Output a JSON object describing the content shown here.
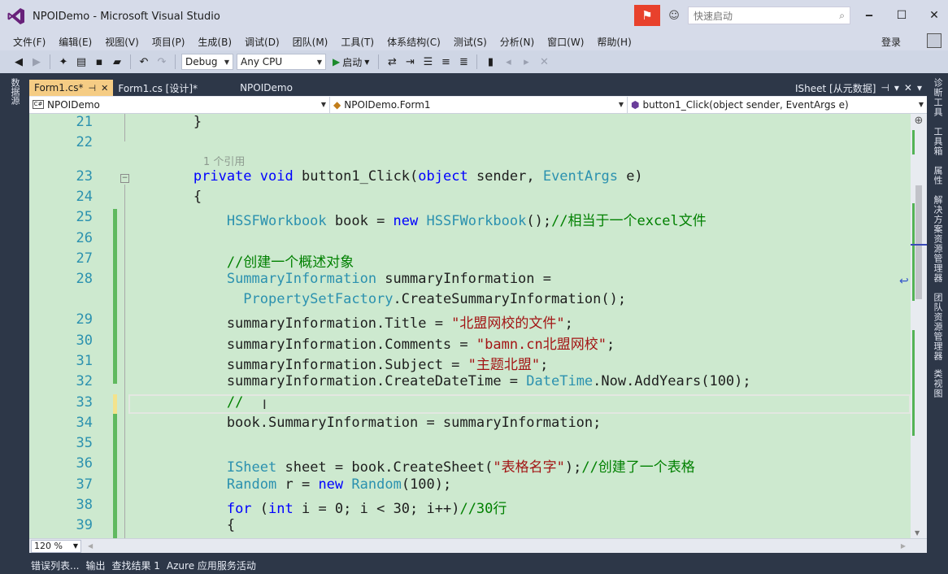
{
  "window": {
    "title": "NPOIDemo - Microsoft Visual Studio",
    "quick_launch_placeholder": "快速启动",
    "login": "登录"
  },
  "menu": [
    "文件(F)",
    "编辑(E)",
    "视图(V)",
    "项目(P)",
    "生成(B)",
    "调试(D)",
    "团队(M)",
    "工具(T)",
    "体系结构(C)",
    "测试(S)",
    "分析(N)",
    "窗口(W)",
    "帮助(H)"
  ],
  "toolbar": {
    "config": "Debug",
    "platform": "Any CPU",
    "start_label": "启动"
  },
  "left_side_tabs": [
    "数据源"
  ],
  "right_side_tabs": [
    "诊断工具",
    "工具箱",
    "属性",
    "解决方案资源管理器",
    "团队资源管理器",
    "类视图"
  ],
  "doc_tabs": [
    {
      "label": "Form1.cs*",
      "active": true
    },
    {
      "label": "Form1.cs [设计]*",
      "active": false
    },
    {
      "label": "NPOIDemo",
      "active": false
    }
  ],
  "doc_tabs_right_label": "ISheet [从元数据]",
  "navbar": {
    "project_icon": "C#",
    "project": "NPOIDemo",
    "class": "NPOIDemo.Form1",
    "member": "button1_Click(object sender, EventArgs e)"
  },
  "codelens": "1 个引用",
  "code": [
    {
      "num": "21",
      "tokens": [
        {
          "t": "        }",
          "c": ""
        }
      ]
    },
    {
      "num": "22",
      "tokens": []
    },
    {
      "num": "23",
      "tokens": [
        {
          "t": "        ",
          "c": ""
        },
        {
          "t": "private",
          "c": "kw"
        },
        {
          "t": " ",
          "c": ""
        },
        {
          "t": "void",
          "c": "kw"
        },
        {
          "t": " button1_Click(",
          "c": ""
        },
        {
          "t": "object",
          "c": "kw"
        },
        {
          "t": " sender, ",
          "c": ""
        },
        {
          "t": "EventArgs",
          "c": "ty"
        },
        {
          "t": " e)",
          "c": ""
        }
      ]
    },
    {
      "num": "24",
      "tokens": [
        {
          "t": "        {",
          "c": ""
        }
      ]
    },
    {
      "num": "25",
      "tokens": [
        {
          "t": "            ",
          "c": ""
        },
        {
          "t": "HSSFWorkbook",
          "c": "ty"
        },
        {
          "t": " book = ",
          "c": ""
        },
        {
          "t": "new",
          "c": "kw"
        },
        {
          "t": " ",
          "c": ""
        },
        {
          "t": "HSSFWorkbook",
          "c": "ty"
        },
        {
          "t": "();",
          "c": ""
        },
        {
          "t": "//相当于一个excel文件",
          "c": "cm"
        }
      ]
    },
    {
      "num": "26",
      "tokens": []
    },
    {
      "num": "27",
      "tokens": [
        {
          "t": "            ",
          "c": ""
        },
        {
          "t": "//创建一个概述对象",
          "c": "cm"
        }
      ]
    },
    {
      "num": "28",
      "tokens": [
        {
          "t": "            ",
          "c": ""
        },
        {
          "t": "SummaryInformation",
          "c": "ty"
        },
        {
          "t": " summaryInformation =",
          "c": ""
        }
      ]
    },
    {
      "num": "",
      "tokens": [
        {
          "t": "              ",
          "c": ""
        },
        {
          "t": "PropertySetFactory",
          "c": "ty"
        },
        {
          "t": ".CreateSummaryInformation();",
          "c": ""
        }
      ]
    },
    {
      "num": "29",
      "tokens": [
        {
          "t": "            summaryInformation.Title = ",
          "c": ""
        },
        {
          "t": "\"北盟网校的文件\"",
          "c": "str"
        },
        {
          "t": ";",
          "c": ""
        }
      ]
    },
    {
      "num": "30",
      "tokens": [
        {
          "t": "            summaryInformation.Comments = ",
          "c": ""
        },
        {
          "t": "\"bamn.cn北盟网校\"",
          "c": "str"
        },
        {
          "t": ";",
          "c": ""
        }
      ]
    },
    {
      "num": "31",
      "tokens": [
        {
          "t": "            summaryInformation.Subject = ",
          "c": ""
        },
        {
          "t": "\"主题北盟\"",
          "c": "str"
        },
        {
          "t": ";",
          "c": ""
        }
      ]
    },
    {
      "num": "32",
      "tokens": [
        {
          "t": "            summaryInformation.CreateDateTime = ",
          "c": ""
        },
        {
          "t": "DateTime",
          "c": "ty"
        },
        {
          "t": ".Now.AddYears(100);",
          "c": ""
        }
      ]
    },
    {
      "num": "33",
      "tokens": [
        {
          "t": "            ",
          "c": ""
        },
        {
          "t": "//",
          "c": "cm"
        }
      ]
    },
    {
      "num": "34",
      "tokens": [
        {
          "t": "            book.SummaryInformation = summaryInformation;",
          "c": ""
        }
      ]
    },
    {
      "num": "35",
      "tokens": []
    },
    {
      "num": "36",
      "tokens": [
        {
          "t": "            ",
          "c": ""
        },
        {
          "t": "ISheet",
          "c": "ty"
        },
        {
          "t": " sheet = book.CreateSheet(",
          "c": ""
        },
        {
          "t": "\"表格名字\"",
          "c": "str"
        },
        {
          "t": ");",
          "c": ""
        },
        {
          "t": "//创建了一个表格",
          "c": "cm"
        }
      ]
    },
    {
      "num": "37",
      "tokens": [
        {
          "t": "            ",
          "c": ""
        },
        {
          "t": "Random",
          "c": "ty"
        },
        {
          "t": " r = ",
          "c": ""
        },
        {
          "t": "new",
          "c": "kw"
        },
        {
          "t": " ",
          "c": ""
        },
        {
          "t": "Random",
          "c": "ty"
        },
        {
          "t": "(100);",
          "c": ""
        }
      ]
    },
    {
      "num": "38",
      "tokens": [
        {
          "t": "            ",
          "c": ""
        },
        {
          "t": "for",
          "c": "kw"
        },
        {
          "t": " (",
          "c": ""
        },
        {
          "t": "int",
          "c": "kw"
        },
        {
          "t": " i = 0; i < 30; i++)",
          "c": ""
        },
        {
          "t": "//30行",
          "c": "cm"
        }
      ]
    },
    {
      "num": "39",
      "tokens": [
        {
          "t": "            {",
          "c": ""
        }
      ]
    }
  ],
  "zoom": "120 %",
  "bottom_tabs": [
    "错误列表...",
    "输出",
    "查找结果 1",
    "Azure 应用服务活动"
  ]
}
